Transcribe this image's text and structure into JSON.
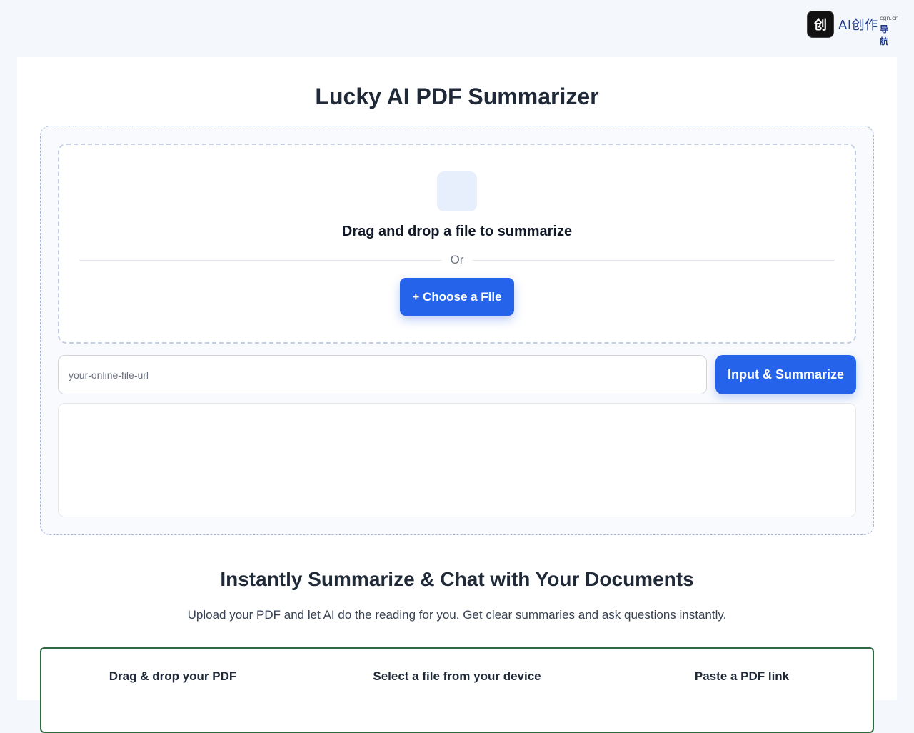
{
  "brand": {
    "logo_glyph": "创",
    "name": "AI创作",
    "domain": "cgn.cn",
    "nav_label": "导航",
    "logo_icon": "brand-logo-icon"
  },
  "page": {
    "title": "Lucky AI PDF Summarizer"
  },
  "uploader": {
    "icon": "file-upload-icon",
    "drop_text": "Drag and drop a file to summarize",
    "divider_text": "Or",
    "choose_button": "+ Choose a File"
  },
  "url_form": {
    "placeholder": "your-online-file-url",
    "value": "",
    "submit_button": "Input & Summarize"
  },
  "result": {
    "text": ""
  },
  "intro": {
    "heading": "Instantly Summarize & Chat with Your Documents",
    "subheading": "Upload your PDF and let AI do the reading for you. Get clear summaries and ask questions instantly."
  },
  "steps": [
    {
      "label": "Drag & drop your PDF"
    },
    {
      "label": "Select a file from your device"
    },
    {
      "label": "Paste a PDF link"
    }
  ],
  "colors": {
    "accent": "#2563eb",
    "steps_border": "#2d6a3e",
    "page_background": "#f4f7fb"
  }
}
